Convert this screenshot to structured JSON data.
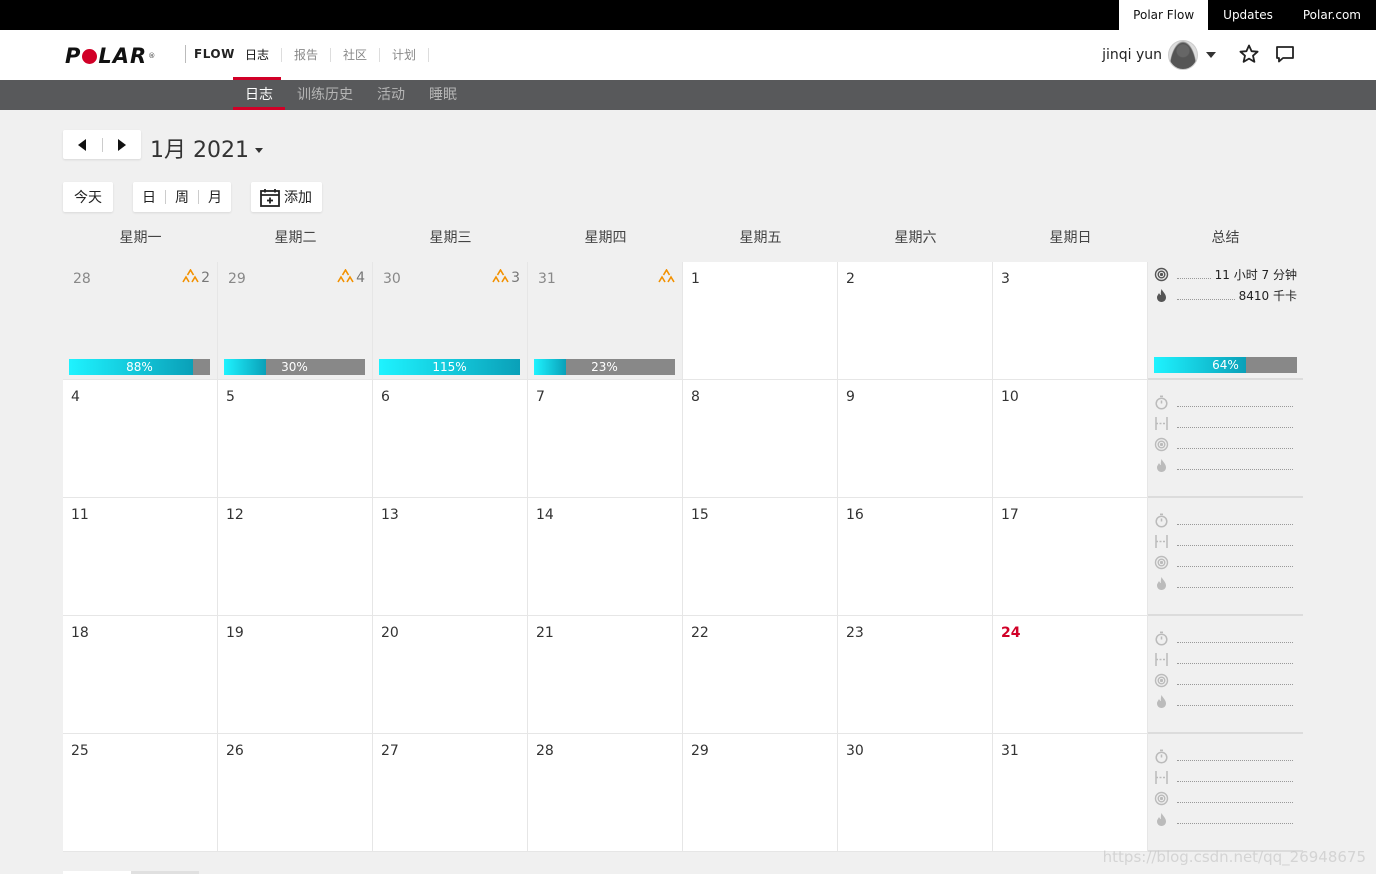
{
  "toplinks": [
    "Polar Flow",
    "Updates",
    "Polar.com"
  ],
  "logo": {
    "text1": "P",
    "text2": "LAR",
    "reg": "®",
    "flow": "FLOW"
  },
  "mainnav": [
    "日志",
    "报告",
    "社区",
    "计划"
  ],
  "user": {
    "name": "jinqi yun"
  },
  "subnav": [
    "日志",
    "训练历史",
    "活动",
    "睡眠"
  ],
  "month_title": "1月 2021",
  "buttons": {
    "today": "今天",
    "day": "日",
    "week": "周",
    "month": "月",
    "add": "添加"
  },
  "weekdays": [
    "星期一",
    "星期二",
    "星期三",
    "星期四",
    "星期五",
    "星期六",
    "星期日",
    "总结"
  ],
  "accent": "#d10027",
  "weeks": [
    {
      "days": [
        {
          "n": "28",
          "prev": true,
          "target": "2",
          "progress": 0.88,
          "label": "88%"
        },
        {
          "n": "29",
          "prev": true,
          "target": "4",
          "progress": 0.3,
          "label": "30%"
        },
        {
          "n": "30",
          "prev": true,
          "target": "3",
          "progress": 1.15,
          "label": "115%"
        },
        {
          "n": "31",
          "prev": true,
          "target": "",
          "progress": 0.23,
          "label": "23%"
        },
        {
          "n": "1"
        },
        {
          "n": "2"
        },
        {
          "n": "3"
        }
      ],
      "summary": {
        "time": "11 小时 7 分钟",
        "calories": "8410 千卡",
        "progress": 0.64,
        "label": "64%"
      }
    },
    {
      "days": [
        {
          "n": "4"
        },
        {
          "n": "5"
        },
        {
          "n": "6"
        },
        {
          "n": "7"
        },
        {
          "n": "8"
        },
        {
          "n": "9"
        },
        {
          "n": "10"
        }
      ]
    },
    {
      "days": [
        {
          "n": "11"
        },
        {
          "n": "12"
        },
        {
          "n": "13"
        },
        {
          "n": "14"
        },
        {
          "n": "15"
        },
        {
          "n": "16"
        },
        {
          "n": "17"
        }
      ]
    },
    {
      "days": [
        {
          "n": "18"
        },
        {
          "n": "19"
        },
        {
          "n": "20"
        },
        {
          "n": "21"
        },
        {
          "n": "22"
        },
        {
          "n": "23"
        },
        {
          "n": "24",
          "today": true
        }
      ]
    },
    {
      "days": [
        {
          "n": "25"
        },
        {
          "n": "26"
        },
        {
          "n": "27"
        },
        {
          "n": "28"
        },
        {
          "n": "29"
        },
        {
          "n": "30"
        },
        {
          "n": "31"
        }
      ]
    }
  ],
  "watermark": "https://blog.csdn.net/qq_26948675"
}
